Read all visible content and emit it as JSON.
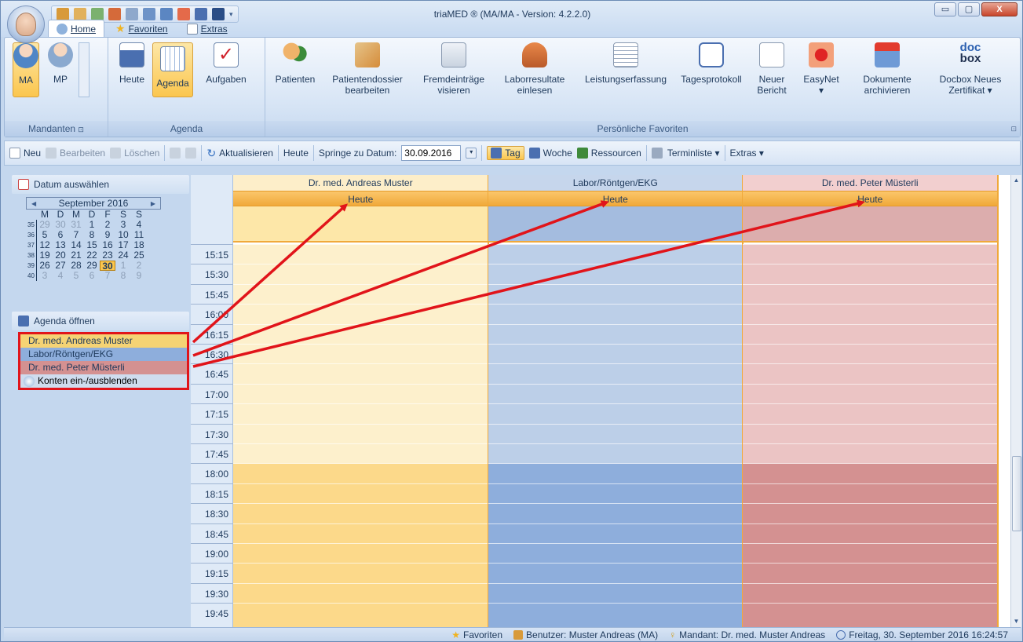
{
  "window": {
    "title": "triaMED ® (MA/MA - Version: 4.2.2.0)",
    "controls": [
      "▭",
      "▢",
      "X"
    ]
  },
  "ribbon_tabs": [
    {
      "label": "Home",
      "icon": "home-icon",
      "active": true
    },
    {
      "label": "Favoriten",
      "icon": "star-icon",
      "active": false
    },
    {
      "label": "Extras",
      "icon": "extras-icon",
      "active": false
    }
  ],
  "ribbon": {
    "mandanten": {
      "label": "Mandanten",
      "ma": "MA",
      "mp": "MP"
    },
    "agenda": {
      "label": "Agenda",
      "heute": "Heute",
      "agenda": "Agenda",
      "aufgaben": "Aufgaben"
    },
    "favoriten": {
      "label": "Persönliche Favoriten",
      "patienten": "Patienten",
      "dossier_1": "Patientendossier",
      "dossier_2": "bearbeiten",
      "fremd_1": "Fremdeinträge",
      "fremd_2": "visieren",
      "labor_1": "Laborresultate",
      "labor_2": "einlesen",
      "leistung": "Leistungserfassung",
      "tages": "Tagesprotokoll",
      "neuer_1": "Neuer",
      "neuer_2": "Bericht",
      "easynet_1": "EasyNet",
      "easynet_2": "▾",
      "dok_1": "Dokumente",
      "dok_2": "archivieren",
      "docbox_1": "Docbox Neues",
      "docbox_2": "Zertifikat ▾",
      "docbox_logo_1": "doc",
      "docbox_logo_2": "box"
    }
  },
  "toolbar": {
    "neu": "Neu",
    "bearbeiten": "Bearbeiten",
    "loeschen": "Löschen",
    "aktualisieren": "Aktualisieren",
    "heute": "Heute",
    "springe": "Springe zu Datum:",
    "date_value": "30.09.2016",
    "tag": "Tag",
    "woche": "Woche",
    "ressourcen": "Ressourcen",
    "terminliste": "Terminliste ▾",
    "extras": "Extras ▾"
  },
  "leftpanel": {
    "datum_header": "Datum auswählen",
    "agenda_header": "Agenda öffnen",
    "calendar": {
      "month": "September 2016",
      "dow": [
        "M",
        "D",
        "M",
        "D",
        "F",
        "S",
        "S"
      ],
      "weeks": [
        {
          "wk": "35",
          "days": [
            "29",
            "30",
            "31",
            "1",
            "2",
            "3",
            "4"
          ]
        },
        {
          "wk": "36",
          "days": [
            "5",
            "6",
            "7",
            "8",
            "9",
            "10",
            "11"
          ]
        },
        {
          "wk": "37",
          "days": [
            "12",
            "13",
            "14",
            "15",
            "16",
            "17",
            "18"
          ]
        },
        {
          "wk": "38",
          "days": [
            "19",
            "20",
            "21",
            "22",
            "23",
            "24",
            "25"
          ]
        },
        {
          "wk": "39",
          "days": [
            "26",
            "27",
            "28",
            "29",
            "30",
            "1",
            "2"
          ]
        },
        {
          "wk": "40",
          "days": [
            "3",
            "4",
            "5",
            "6",
            "7",
            "8",
            "9"
          ]
        }
      ]
    },
    "agenda_items": [
      "Dr. med. Andreas Muster",
      "Labor/Röntgen/EKG",
      "Dr. med. Peter Müsterli"
    ],
    "konten": "Konten ein-/ausblenden"
  },
  "resources": [
    {
      "name": "Dr. med. Andreas Muster",
      "heute": "Heute",
      "head_color": "#fdeec9",
      "allday_color": "#fde7a8",
      "body_color": "#fdf0cc",
      "evening_color": "#fcd98a"
    },
    {
      "name": "Labor/Röntgen/EKG",
      "heute": "Heute",
      "head_color": "#c6d6ec",
      "allday_color": "#a4bcdf",
      "body_color": "#bccfe8",
      "evening_color": "#8eaedc"
    },
    {
      "name": "Dr. med. Peter Müsterli",
      "heute": "Heute",
      "head_color": "#f2cfcf",
      "allday_color": "#dcadad",
      "body_color": "#ebc4c4",
      "evening_color": "#d49191"
    }
  ],
  "times": [
    "15:15",
    "15:30",
    "15:45",
    "16:00",
    "16:15",
    "16:30",
    "16:45",
    "17:00",
    "17:15",
    "17:30",
    "17:45",
    "18:00",
    "18:15",
    "18:30",
    "18:45",
    "19:00",
    "19:15",
    "19:30",
    "19:45"
  ],
  "statusbar": {
    "favoriten": "Favoriten",
    "benutzer": "Benutzer: Muster Andreas  (MA)",
    "mandant": "Mandant: Dr. med. Muster Andreas",
    "datum": "Freitag, 30. September 2016 16:24:57"
  },
  "colors": {
    "accent": "#fbc64e",
    "annotation": "#e1141a"
  }
}
